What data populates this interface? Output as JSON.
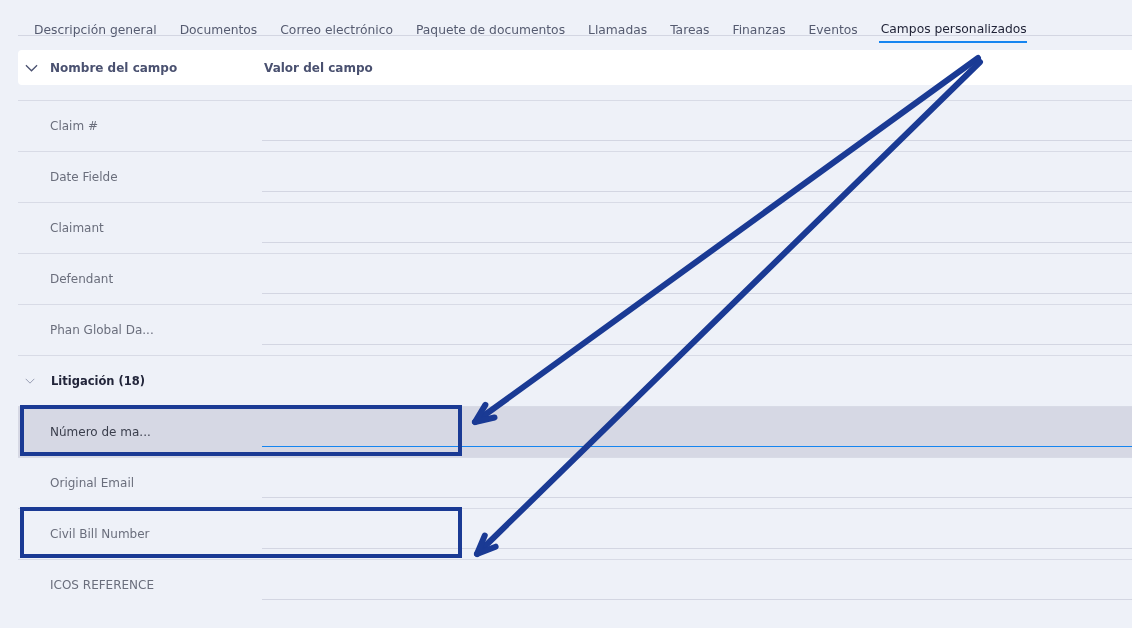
{
  "tabs": [
    {
      "label": "Descripción general",
      "selected": false
    },
    {
      "label": "Documentos",
      "selected": false
    },
    {
      "label": "Correo electrónico",
      "selected": false
    },
    {
      "label": "Paquete de documentos",
      "selected": false
    },
    {
      "label": "Llamadas",
      "selected": false
    },
    {
      "label": "Tareas",
      "selected": false
    },
    {
      "label": "Finanzas",
      "selected": false
    },
    {
      "label": "Eventos",
      "selected": false
    },
    {
      "label": "Campos personalizados",
      "selected": true
    }
  ],
  "table": {
    "columns": [
      "Nombre del campo",
      "Valor del campo"
    ],
    "expanded": true,
    "rows": [
      {
        "kind": "field",
        "name": "Claim #",
        "selected": false,
        "marked": false
      },
      {
        "kind": "field",
        "name": "Date Fielde",
        "selected": false,
        "marked": false
      },
      {
        "kind": "field",
        "name": "Claimant",
        "selected": false,
        "marked": false
      },
      {
        "kind": "field",
        "name": "Defendant",
        "selected": false,
        "marked": false
      },
      {
        "kind": "field",
        "name": "Phan Global Da...",
        "selected": false,
        "marked": false
      },
      {
        "kind": "group",
        "name": "Litigación (18)",
        "expanded": true
      },
      {
        "kind": "field",
        "name": "Número de ma...",
        "selected": true,
        "marked": true
      },
      {
        "kind": "field",
        "name": "Original Email",
        "selected": false,
        "marked": false
      },
      {
        "kind": "field",
        "name": "Civil Bill Number",
        "selected": false,
        "marked": true
      },
      {
        "kind": "field",
        "name": "ICOS REFERENCE",
        "selected": false,
        "marked": false
      }
    ]
  }
}
